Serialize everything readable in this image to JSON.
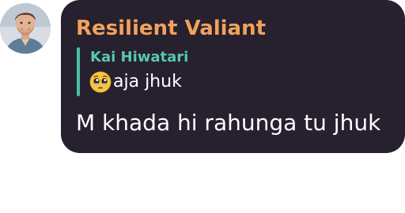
{
  "message": {
    "sender_name": "Resilient Valiant",
    "avatar": "user-avatar-photo",
    "reply": {
      "author": "Kai Hiwatari",
      "emoji": "pleading-face-emoji",
      "text": "aja jhuk"
    },
    "body": "M khada hi rahunga tu jhuk"
  },
  "colors": {
    "bubble_background": "#26202f",
    "sender_name": "#f2a15b",
    "reply_author": "#57c8ad",
    "reply_bar": "#48c1a6",
    "text": "#ffffff",
    "page_background": "#ffffff"
  }
}
